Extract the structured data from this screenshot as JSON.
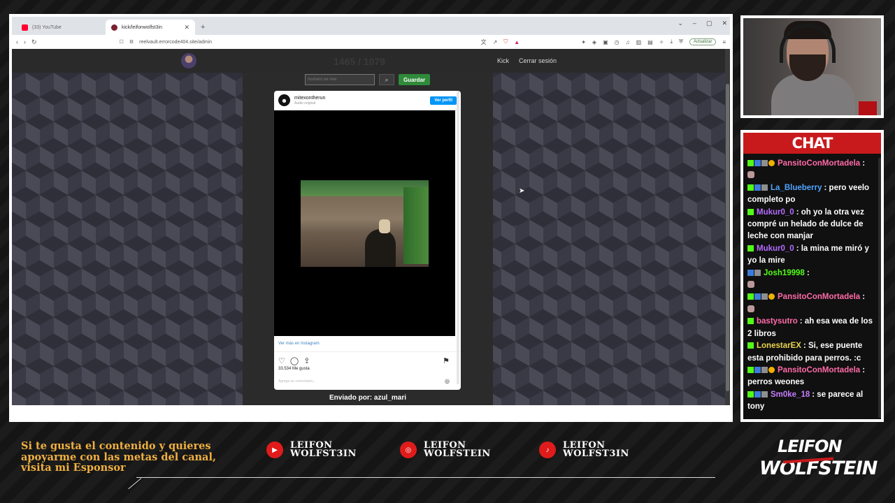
{
  "browser": {
    "tabs": [
      {
        "label": "(33) YouTube",
        "active": false,
        "favicon": "youtube-icon"
      },
      {
        "label": "kick/leifonwolfst3in",
        "active": true,
        "favicon": "kick-icon"
      }
    ],
    "new_tab": "+",
    "window_controls": {
      "collapse": "⌄",
      "minimize": "–",
      "maximize": "▢",
      "close": "✕"
    },
    "url": "reelvault.errorcode404.site/admin",
    "update_label": "Actualizar"
  },
  "site": {
    "nav": {
      "kick": "Kick",
      "logout": "Cerrar sesión"
    },
    "counter": "1465 / 1079",
    "reel_input": {
      "placeholder": "Numero de reel",
      "value": ""
    },
    "save_label": "Guardar",
    "prev_arrow": "←",
    "next_arrow": "→",
    "sender": "Enviado por: azul_mari"
  },
  "instagram": {
    "username": "mitexontherun",
    "audio": "Audio original",
    "profile_button": "Ver perfil",
    "more_link": "Ver más en Instagram",
    "likes": "33.534 Me gusta",
    "comment_placeholder": "Agrega un comentario..."
  },
  "chat": {
    "title": "CHAT",
    "messages": [
      {
        "user": "PansitoConMortadela",
        "user_color": "#ff6aa8",
        "badges": [
          "k",
          "v",
          "s",
          "o"
        ],
        "text": ":",
        "emote": true
      },
      {
        "user": "La_Blueberry",
        "user_color": "#4fa3ff",
        "badges": [
          "k",
          "v",
          "s"
        ],
        "text": ": pero veelo completo po",
        "emote": false
      },
      {
        "user": "Mukur0_0",
        "user_color": "#b36bff",
        "badges": [
          "k"
        ],
        "text": ": oh yo la otra vez compré un helado de dulce de leche con manjar",
        "emote": false
      },
      {
        "user": "Mukur0_0",
        "user_color": "#b36bff",
        "badges": [
          "k"
        ],
        "text": ": la mina me miró y yo la mire",
        "emote": false
      },
      {
        "user": "Josh19998",
        "user_color": "#53fc18",
        "badges": [
          "v",
          "s"
        ],
        "text": ":",
        "emote": true
      },
      {
        "user": "PansitoConMortadela",
        "user_color": "#ff6aa8",
        "badges": [
          "k",
          "v",
          "s",
          "o"
        ],
        "text": ":",
        "emote": true
      },
      {
        "user": "bastysutro",
        "user_color": "#ff6aa8",
        "badges": [
          "k"
        ],
        "text": ": ah esa wea de los 2 libros",
        "emote": false
      },
      {
        "user": "LonestarEX",
        "user_color": "#e8d44d",
        "badges": [
          "k"
        ],
        "text": ": Si, ese puente esta prohibido para perros. :c",
        "emote": false
      },
      {
        "user": "PansitoConMortadela",
        "user_color": "#ff6aa8",
        "badges": [
          "k",
          "v",
          "s",
          "o"
        ],
        "text": ": perros weones",
        "emote": false
      },
      {
        "user": "Sm0ke_18",
        "user_color": "#c77dff",
        "badges": [
          "k",
          "v",
          "s"
        ],
        "text": ": se parece al tony",
        "emote": false
      }
    ]
  },
  "overlay": {
    "promo": "Si te gusta el contenido y quieres apoyarme con las metas del canal, visita mi Esponsor",
    "socials": [
      {
        "icon": "youtube-icon",
        "line1": "LEIFON",
        "line2": "WOLFST3IN"
      },
      {
        "icon": "instagram-icon",
        "line1": "LEIFON",
        "line2": "WOLFSTEIN"
      },
      {
        "icon": "tiktok-icon",
        "line1": "LEIFON",
        "line2": "WOLFST3IN"
      }
    ],
    "brand_line1": "LEIFON",
    "brand_line2": "WOLFSTEIN"
  },
  "colors": {
    "accent_red": "#c81a1c",
    "kick_green": "#53fc18",
    "save_green": "#2f8a3a",
    "ig_blue": "#0095f6",
    "promo_gold": "#f0b040"
  }
}
